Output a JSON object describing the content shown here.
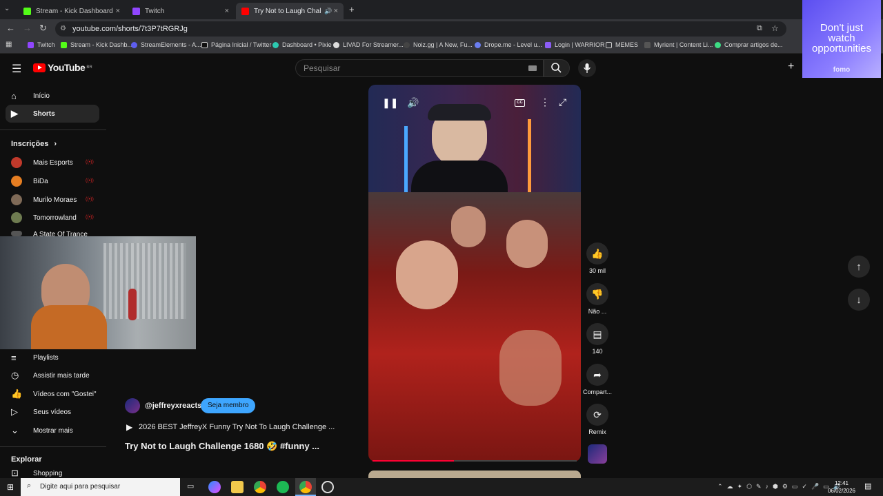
{
  "browser": {
    "tabs": [
      {
        "label": "Stream - Kick Dashboard",
        "close": "×"
      },
      {
        "label": "Twitch",
        "close": "×"
      },
      {
        "label": "Try Not to Laugh Challenge",
        "close": "×"
      }
    ],
    "new_tab": "+",
    "url": "youtube.com/shorts/7t3P7tRGRJg",
    "bookmarks": [
      "Twitch",
      "Stream - Kick Dashb...",
      "StreamElements - A...",
      "Página Inicial / Twitter",
      "Dashboard • Pixie",
      "LIVAD For Streamer...",
      "Noiz.gg | A New, Fu...",
      "Drope.me - Level u...",
      "Login | WARRIOR",
      "MEMES",
      "Myrient | Content Li...",
      "Comprar artigos de..."
    ]
  },
  "youtube": {
    "logo_text": "YouTube",
    "logo_region": "BR",
    "search_placeholder": "Pesquisar",
    "nav": {
      "home": "Início",
      "shorts": "Shorts"
    },
    "subscriptions_title": "Inscrições",
    "subscriptions": [
      "Mais Esports",
      "BiDa",
      "Murilo Moraes",
      "Tomorrowland",
      "A State Of Trance"
    ],
    "library": [
      "Playlists",
      "Assistir mais tarde",
      "Vídeos com \"Gostei\"",
      "Seus vídeos",
      "Mostrar mais"
    ],
    "explore_title": "Explorar",
    "explore_items": [
      "Shopping"
    ],
    "short": {
      "channel": "@jeffreyxreacts",
      "join": "Seja membro",
      "playlist": "2026 BEST JeffreyX Funny Try Not To Laugh Challenge ...",
      "title": "Try Not to Laugh Challenge 1680 🤣 #funny ...",
      "progress": 0.4
    },
    "actions": {
      "likes": "30 mil",
      "dislike": "Não ...",
      "comments": "140",
      "share": "Compart...",
      "remix": "Remix"
    },
    "ad": {
      "text": "Don't just watch opportunities",
      "brand": "fomo"
    }
  },
  "taskbar": {
    "search": "Digite aqui para pesquisar",
    "time": "12:41",
    "date": "06/02/2026"
  }
}
